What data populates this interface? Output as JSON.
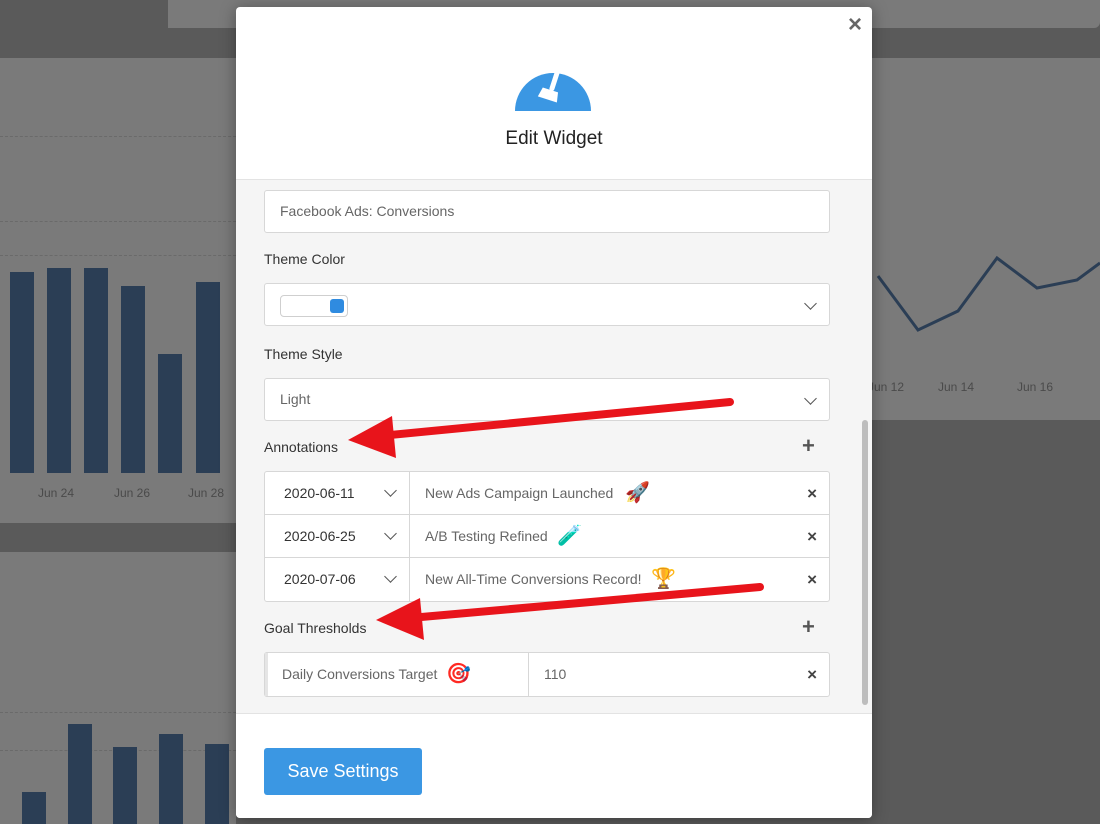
{
  "background": {
    "left_ticks": [
      "Jun 24",
      "Jun 26",
      "Jun 28"
    ],
    "right_ticks": [
      "Jun 12",
      "Jun 14",
      "Jun 16"
    ]
  },
  "modal": {
    "title": "Edit Widget",
    "close_glyph": "×",
    "icon": "broom-gauge-icon"
  },
  "form": {
    "widget_name_value": "Facebook Ads: Conversions",
    "theme_color_label": "Theme Color",
    "theme_color_value": "#2f8be0",
    "theme_style_label": "Theme Style",
    "theme_style_value": "Light",
    "annotations_label": "Annotations",
    "add_glyph": "+",
    "remove_glyph": "×",
    "annotations": [
      {
        "date": "2020-06-11",
        "text": "New Ads Campaign Launched",
        "icon": "🚀"
      },
      {
        "date": "2020-06-25",
        "text": "A/B Testing Refined",
        "icon": "🧪"
      },
      {
        "date": "2020-07-06",
        "text": "New All-Time Conversions Record!",
        "icon": "🏆"
      }
    ],
    "goals_label": "Goal Thresholds",
    "goals": [
      {
        "name": "Daily Conversions Target",
        "icon": "🎯",
        "value": "110"
      }
    ]
  },
  "footer": {
    "save_label": "Save Settings"
  },
  "colors": {
    "accent": "#3b97e3",
    "arrow": "#e8141b"
  }
}
